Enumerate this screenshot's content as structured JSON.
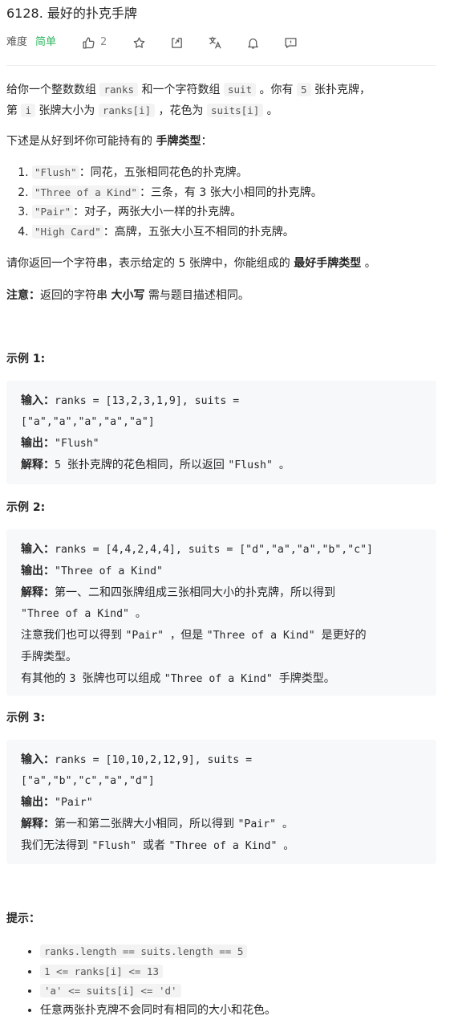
{
  "header": {
    "title": "6128. 最好的扑克手牌",
    "difficulty_label": "难度",
    "difficulty": "简单",
    "like_count": "2",
    "icons": [
      "thumbs-up-icon",
      "star-icon",
      "share-icon",
      "translate-icon",
      "bell-icon",
      "comment-icon"
    ]
  },
  "description": {
    "p1": {
      "t1": "给你一个整数数组 ",
      "c1": "ranks",
      "t2": " 和一个字符数组 ",
      "c2": "suit",
      "t3": " 。你有 ",
      "c3": "5",
      "t4": " 张扑克牌，",
      "t5": "第 ",
      "c4": "i",
      "t6": " 张牌大小为 ",
      "c5": "ranks[i]",
      "t7": " ，花色为 ",
      "c6": "suits[i]",
      "t8": " 。"
    },
    "p2": {
      "t1": "下述是从好到坏你可能持有的 ",
      "b1": "手牌类型",
      "t2": "："
    },
    "types": [
      {
        "code": "\"Flush\"",
        "text": "：同花，五张相同花色的扑克牌。"
      },
      {
        "code": "\"Three of a Kind\"",
        "text": "：三条，有 3 张大小相同的扑克牌。"
      },
      {
        "code": "\"Pair\"",
        "text": "：对子，两张大小一样的扑克牌。"
      },
      {
        "code": "\"High Card\"",
        "text": "：高牌，五张大小互不相同的扑克牌。"
      }
    ],
    "p3": {
      "t1": "请你返回一个字符串，表示给定的 5 张牌中，你能组成的 ",
      "b1": "最好手牌类型",
      "t2": " 。"
    },
    "p4": {
      "b1": "注意：",
      "t1": "返回的字符串 ",
      "b2": "大小写",
      "t2": " 需与题目描述相同。"
    }
  },
  "examples": [
    {
      "title": "示例 1:",
      "input_label": "输入：",
      "input_l1": "ranks = [13,2,3,1,9], suits =",
      "input_l2": "[\"a\",\"a\",\"a\",\"a\",\"a\"]",
      "output_label": "输出：",
      "output": "\"Flush\"",
      "explain_label": "解释：",
      "explain_l1a": "5 ",
      "explain_l1b": "张扑克牌的花色相同，所以返回 ",
      "explain_l1c": "\"Flush\" 。"
    },
    {
      "title": "示例 2:",
      "input_label": "输入：",
      "input_l1": "ranks = [4,4,2,4,4], suits = [\"d\",\"a\",\"a\",\"b\",\"c\"]",
      "output_label": "输出：",
      "output": "\"Three of a Kind\"",
      "explain_label": "解释：",
      "explain_l1": "第一、二和四张牌组成三张相同大小的扑克牌，所以得到",
      "explain_l2": "\"Three of a Kind\" 。",
      "explain_l3a": "注意我们也可以得到 ",
      "explain_l3b": "\"Pair\" ，",
      "explain_l3c": "但是 ",
      "explain_l3d": "\"Three of a Kind\" ",
      "explain_l3e": "是更好的",
      "explain_l4": "手牌类型。",
      "explain_l5a": "有其他的 ",
      "explain_l5b": "3 ",
      "explain_l5c": "张牌也可以组成 ",
      "explain_l5d": "\"Three of a Kind\" ",
      "explain_l5e": "手牌类型。"
    },
    {
      "title": "示例 3:",
      "input_label": "输入：",
      "input_l1": "ranks = [10,10,2,12,9], suits =",
      "input_l2": "[\"a\",\"b\",\"c\",\"a\",\"d\"]",
      "output_label": "输出：",
      "output": "\"Pair\"",
      "explain_label": "解释：",
      "explain_l1a": "第一和第二张牌大小相同，所以得到 ",
      "explain_l1b": "\"Pair\" 。",
      "explain_l2a": "我们无法得到 ",
      "explain_l2b": "\"Flush\" ",
      "explain_l2c": "或者 ",
      "explain_l2d": "\"Three of a Kind\" 。"
    }
  ],
  "hints": {
    "title": "提示：",
    "items": [
      "ranks.length == suits.length == 5",
      "1 <= ranks[i] <= 13",
      "'a' <= suits[i] <= 'd'",
      "任意两张扑克牌不会同时有相同的大小和花色。"
    ]
  }
}
